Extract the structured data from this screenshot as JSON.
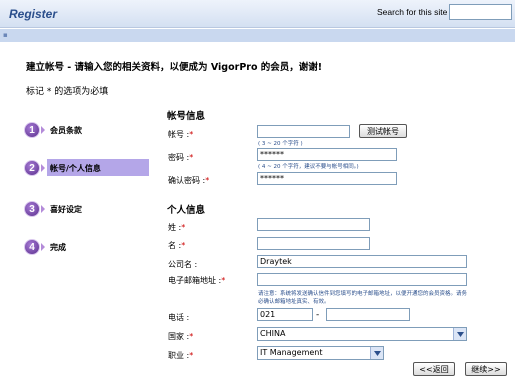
{
  "header": {
    "title": "Register",
    "search_label": "Search for this site",
    "search_value": ""
  },
  "intro": {
    "heading": "建立帐号 - 请输入您的相关资料，以便成为 VigorPro 的会员，谢谢!",
    "note": "标记 * 的选项为必填"
  },
  "steps": [
    {
      "number": "1",
      "label": "会员条款"
    },
    {
      "number": "2",
      "label": "帐号/个人信息"
    },
    {
      "number": "3",
      "label": "喜好设定"
    },
    {
      "number": "4",
      "label": "完成"
    }
  ],
  "account": {
    "section_title": "帐号信息",
    "username_label": "帐号 :",
    "username_value": "",
    "username_hint": "( 3 ~ 20 个字符 )",
    "test_button": "测试帐号",
    "password_label": "密码 :",
    "password_value": "******",
    "password_hint": "( 4 ~ 20 个字符，建议不要与帐号相同。)",
    "confirm_label": "确认密码 :",
    "confirm_value": "******"
  },
  "personal": {
    "section_title": "个人信息",
    "lastname_label": "姓 :",
    "lastname_value": "",
    "firstname_label": "名 :",
    "firstname_value": "",
    "company_label": "公司名 :",
    "company_value": "Draytek",
    "email_label": "电子邮箱地址 :",
    "email_value": "",
    "email_hint_line1": "请注意：系统将发送确认信件到您填写的电子邮箱地址，以便开通您的会员资格。请务",
    "email_hint_line2": "必确认邮箱地址真实、有效。",
    "phone_label": "电话 :",
    "phone_area": "021",
    "phone_dash": "-",
    "phone_number": "",
    "country_label": "国家 :",
    "country_value": "CHINA",
    "job_label": "职业 :",
    "job_value": "IT Management"
  },
  "buttons": {
    "back": "<<返回",
    "next": "继续>>"
  },
  "colors": {
    "title": "#2b4f8c",
    "active_step_bg": "#b4a6e8",
    "step_icon": "#5a2f8c",
    "required": "#cc0000"
  }
}
